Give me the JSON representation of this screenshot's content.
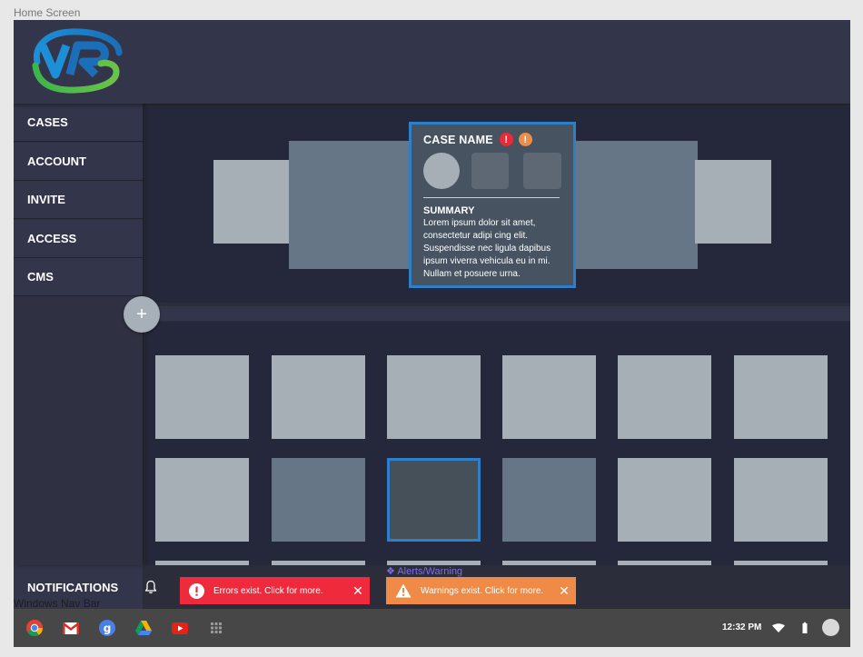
{
  "frame": {
    "label": "Home Screen"
  },
  "logo": {
    "text": "VR"
  },
  "sidebar": {
    "items": [
      {
        "label": "CASES"
      },
      {
        "label": "ACCOUNT"
      },
      {
        "label": "INVITE"
      },
      {
        "label": "ACCESS"
      },
      {
        "label": "CMS"
      }
    ]
  },
  "add_button": {
    "label": "+"
  },
  "case_card": {
    "title": "CASE NAME",
    "error_badge": "!",
    "warning_badge": "!",
    "summary_title": "SUMMARY",
    "summary_text": "Lorem ipsum dolor sit amet, consectetur adipi cing elit. Suspendisse nec ligula dapibus ipsum viverra vehicula eu in mi. Nullam et posuere urna."
  },
  "notifications": {
    "label": "NOTIFICATIONS",
    "alerts_label": "Alerts/Warning",
    "nav_bar_label": "Windows Nav Bar",
    "error": {
      "text": "Errors exist. Click for more.",
      "close": "✕"
    },
    "warning": {
      "text": "Warnings exist. Click for more.",
      "close": "✕"
    }
  },
  "taskbar": {
    "apps": [
      "chrome-icon",
      "gmail-icon",
      "google-icon",
      "drive-icon",
      "youtube-icon",
      "app-launcher-icon"
    ],
    "time": "12:32 PM"
  },
  "colors": {
    "accent": "#2c7fc8",
    "error": "#ef2a3d",
    "warning": "#f08b47",
    "background": "#2b2d3a"
  }
}
